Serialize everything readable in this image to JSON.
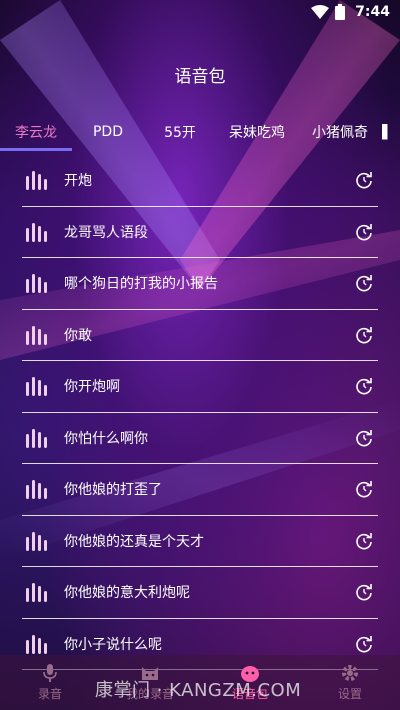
{
  "status_bar": {
    "time": "7:44"
  },
  "header": {
    "title": "语音包"
  },
  "tabs": [
    {
      "label": "李云龙",
      "active": true
    },
    {
      "label": "PDD",
      "active": false
    },
    {
      "label": "55开",
      "active": false
    },
    {
      "label": "呆妹吃鸡",
      "active": false
    },
    {
      "label": "小猪佩奇",
      "active": false
    }
  ],
  "clips": [
    {
      "label": "开炮"
    },
    {
      "label": "龙哥骂人语段"
    },
    {
      "label": "哪个狗日的打我的小报告"
    },
    {
      "label": "你敢"
    },
    {
      "label": "你开炮啊"
    },
    {
      "label": "你怕什么啊你"
    },
    {
      "label": "你他娘的打歪了"
    },
    {
      "label": "你他娘的还真是个天才"
    },
    {
      "label": "你他娘的意大利炮呢"
    },
    {
      "label": "你小子说什么呢"
    }
  ],
  "bottom_nav": [
    {
      "label": "录音",
      "icon": "microphone-icon",
      "active": false
    },
    {
      "label": "我的录音",
      "icon": "cat-face-icon",
      "active": false
    },
    {
      "label": "语音包",
      "icon": "face-icon",
      "active": true
    },
    {
      "label": "设置",
      "icon": "gear-icon",
      "active": false
    }
  ],
  "watermark": {
    "text": "康掌门 · KANGZM.COM"
  },
  "colors": {
    "accent": "#e87ac4",
    "underline": "#7a6cf0",
    "nav_active": "#ff5fa8",
    "nav_inactive": "#9a6a8a"
  }
}
